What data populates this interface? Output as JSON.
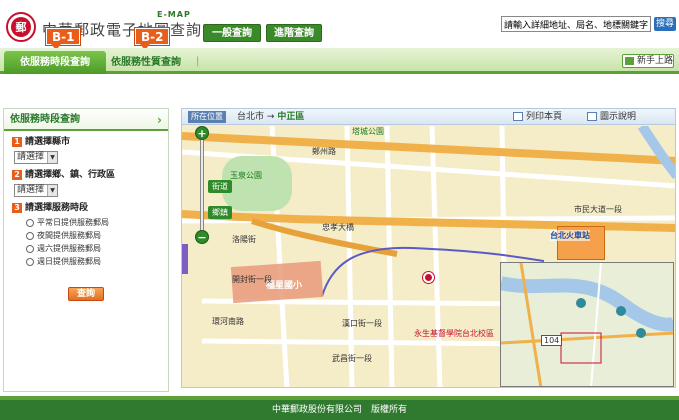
{
  "header": {
    "logo_char": "郵",
    "emap_label": "E-MAP",
    "title": "中華郵政電子地圖查詢",
    "badge_b1": "B-1",
    "badge_b2": "B-2",
    "btn_general": "一般查詢",
    "btn_advanced": "進階查詢",
    "search_placeholder": "請輸入詳細地址、局名、地標關鍵字",
    "search_button": "搜尋"
  },
  "tabs": {
    "active": "依服務時段查詢",
    "second": "依服務性質查詢",
    "help": "新手上路"
  },
  "sidebar": {
    "title": "依服務時段查詢",
    "step1_num": "1",
    "step1_label": "請選擇縣市",
    "step1_select": "請選擇",
    "step2_num": "2",
    "step2_label": "請選擇鄉、鎮、行政區",
    "step2_select": "請選擇",
    "step3_num": "3",
    "step3_label": "請選擇服務時段",
    "options": [
      "平常日提供服務郵局",
      "夜間提供服務郵局",
      "週六提供服務郵局",
      "週日提供服務郵局"
    ],
    "query_button": "查詢"
  },
  "map": {
    "location_label": "所在位置",
    "city": "台北市",
    "arrow": "→",
    "district": "中正區",
    "print_label": "列印本頁",
    "legend_label": "圖示說明",
    "zoom_street": "街道",
    "zoom_town": "鄉鎮",
    "labels": {
      "park": "玉泉公園",
      "station": "台北火車站",
      "school": "福星國小",
      "road1": "忠孝大橋",
      "road2": "鄭州路",
      "road3": "市民大道一段",
      "road4": "開封街一段",
      "road5": "漢口街一段",
      "road6": "武昌街一段",
      "hospital": "永生基督學院台北校區",
      "park2": "塔城公園",
      "road7": "洛陽街",
      "road8": "環河南路",
      "route": "104"
    }
  },
  "footer": {
    "copyright": "中華郵政股份有限公司　版權所有"
  }
}
